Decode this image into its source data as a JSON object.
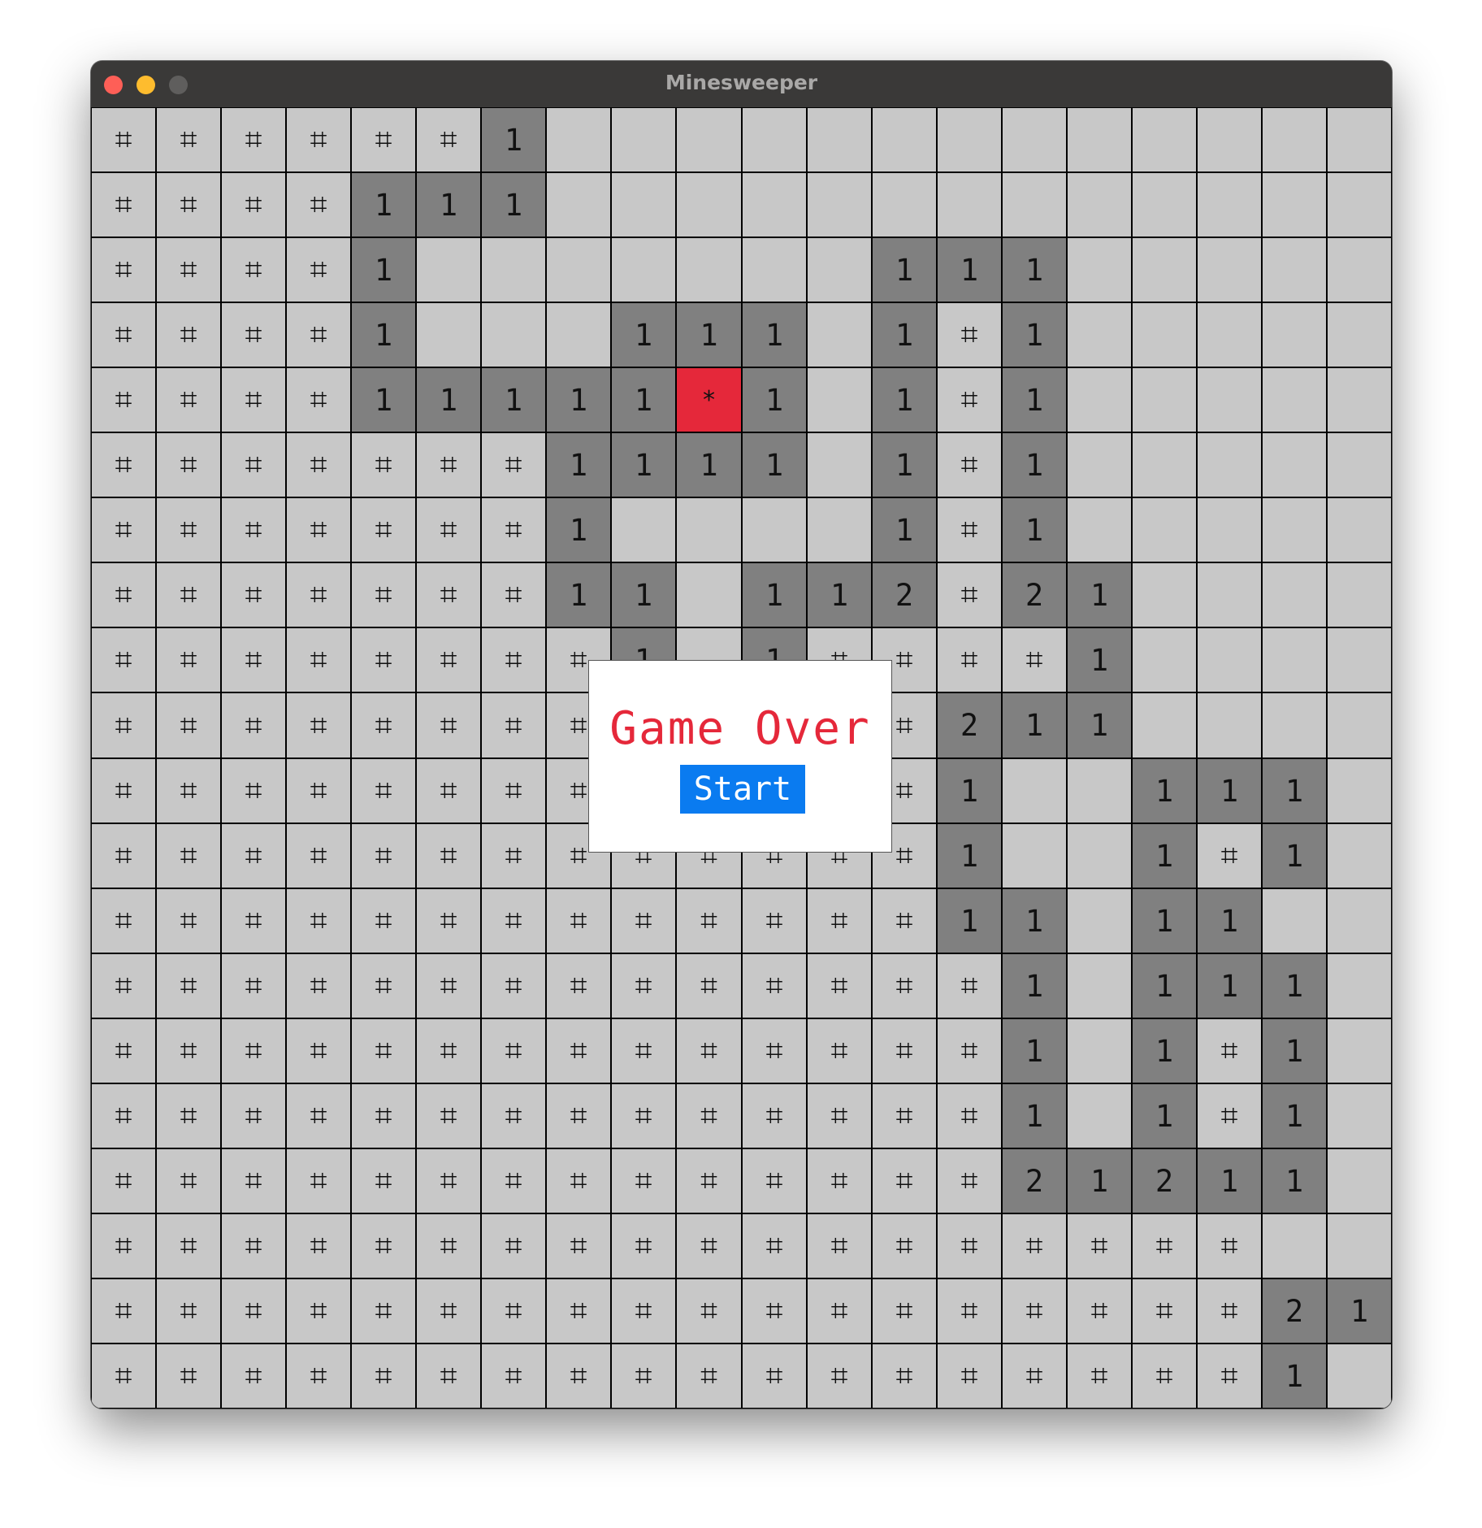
{
  "window": {
    "title": "Minesweeper"
  },
  "board": {
    "rows": 20,
    "cols": 20,
    "grid": [
      "######1.............",
      "####111.............",
      "####1.......111.....",
      "####1...111.1#1.....",
      "####11111*1.1#1.....",
      "#######1111.1#1.....",
      "#######1....1#1.....",
      "#######11.112#21....",
      "########1.1####1....",
      "#############211....",
      "#############1..111.",
      "#############1..1#1.",
      "#############11.11..",
      "##############1.111.",
      "##############1.1#1.",
      "##############1.1#1.",
      "##############21211.",
      "##################..",
      "##################21",
      "##################1."
    ],
    "legend": {
      "#": "covered",
      "digit": "revealed number",
      ".": "revealed empty",
      "*": "exploded mine"
    },
    "symbols": {
      "covered": "⌗",
      "mine": "*"
    },
    "colors": {
      "covered": "#c8c8c8",
      "number": "#808080",
      "empty": "#c8c8c8",
      "mine": "#e5283a"
    }
  },
  "dialog": {
    "title": "Game Over",
    "button_label": "Start",
    "title_color": "#e5283a",
    "button_color": "#0a7bf0"
  }
}
